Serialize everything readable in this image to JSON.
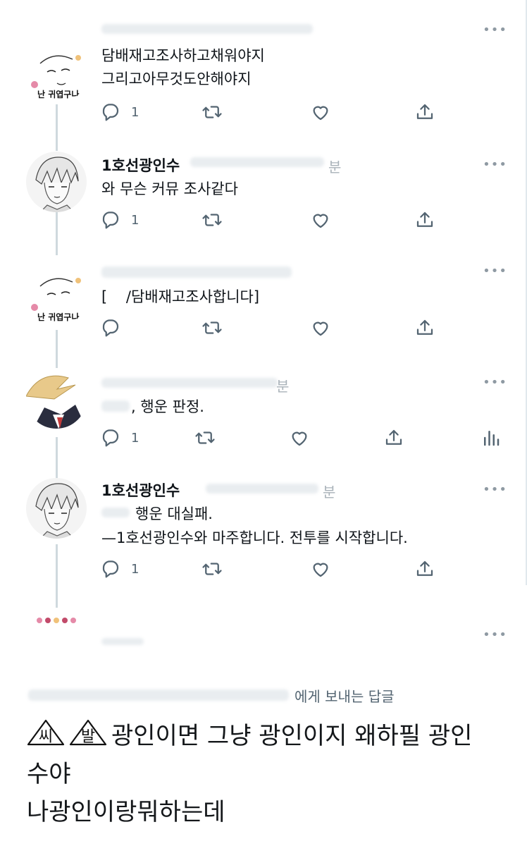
{
  "tweets": [
    {
      "name": "",
      "time": "",
      "lines": [
        "담배재고조사하고채워야지",
        "그리고아무것도안해야지"
      ],
      "reply_count": "1",
      "avatar_caption": "난 귀엽구나"
    },
    {
      "name": "1호선광인수",
      "time": "분",
      "lines": [
        "와 무슨 커뮤 조사같다"
      ],
      "reply_count": "1"
    },
    {
      "name": "",
      "time": "",
      "lines": [
        "[    /담배재고조사합니다]"
      ],
      "reply_count": "",
      "avatar_caption": "난 귀엽구나"
    },
    {
      "name": "",
      "time": "분",
      "lines": ", 행운 판정.",
      "reply_count": "1"
    },
    {
      "name": "1호선광인수",
      "time": "분",
      "lines": [
        "행운 대실패.",
        "—1호선광인수와 마주합니다. 전투를 시작합니다."
      ],
      "reply_count": "1"
    }
  ],
  "more_label": "•••",
  "compose": {
    "reply_to": "에게 보내는 답글",
    "glyph_1": "씨",
    "glyph_2": "발",
    "line_1": "광인이면 그냥 광인이지 왜하필 광인",
    "line_2": "수야",
    "line_3": "나광인이랑뭐하는데"
  },
  "icons": [
    "reply-icon",
    "retweet-icon",
    "like-icon",
    "share-icon",
    "analytics-icon",
    "more-icon"
  ],
  "colors": {
    "text": "#0f1419",
    "muted": "#536471",
    "thread": "#cfd9de"
  }
}
